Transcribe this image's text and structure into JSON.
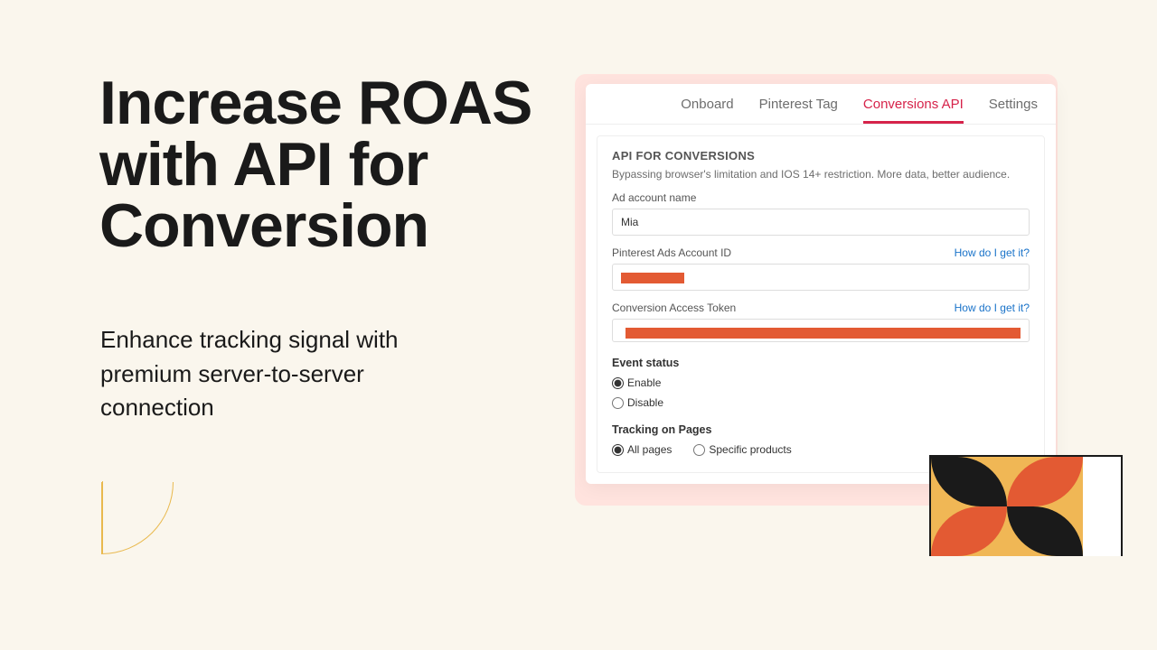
{
  "promo": {
    "headline": "Increase ROAS with API for Conversion",
    "subhead": "Enhance tracking signal with premium server-to-server connection"
  },
  "tabs": {
    "onboard": "Onboard",
    "pinterest_tag": "Pinterest Tag",
    "conversions_api": "Conversions API",
    "settings": "Settings"
  },
  "card": {
    "title": "API FOR CONVERSIONS",
    "desc": "Bypassing browser's limitation and IOS 14+ restriction. More data, better audience.",
    "ad_account_name_label": "Ad account name",
    "ad_account_name_value": "Mia",
    "ads_account_id_label": "Pinterest Ads Account ID",
    "access_token_label": "Conversion Access Token",
    "help_link": "How do I get it?",
    "event_status_label": "Event status",
    "enable_label": "Enable",
    "disable_label": "Disable",
    "tracking_label": "Tracking on Pages",
    "all_pages_label": "All pages",
    "specific_label": "Specific products"
  }
}
